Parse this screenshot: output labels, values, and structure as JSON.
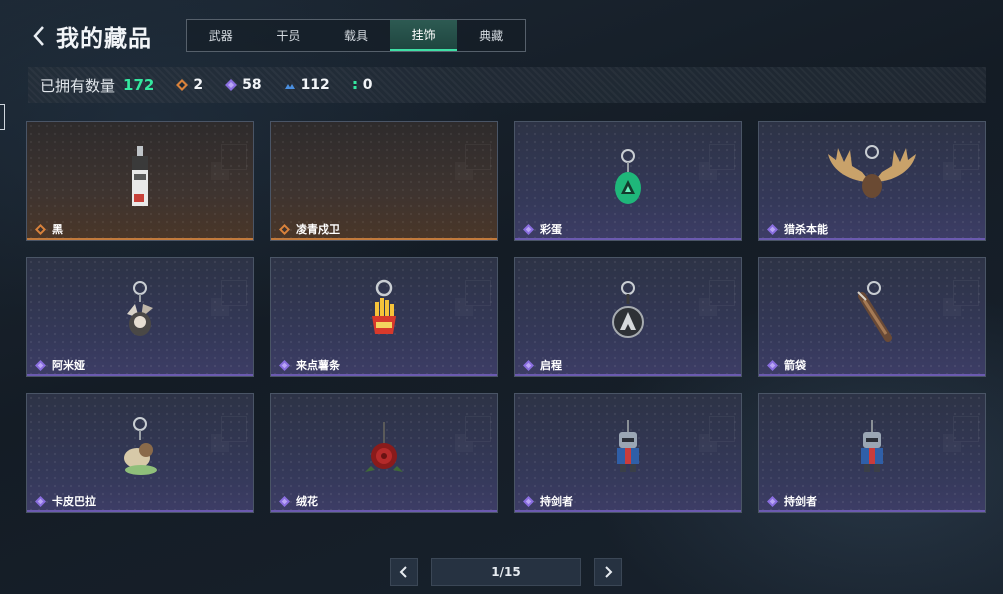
{
  "header": {
    "title": "我的藏品",
    "back_icon": "chevron-left-icon"
  },
  "tabs": [
    {
      "label": "武器",
      "active": false
    },
    {
      "label": "干员",
      "active": false
    },
    {
      "label": "载具",
      "active": false
    },
    {
      "label": "挂饰",
      "active": true
    },
    {
      "label": "典藏",
      "active": false
    }
  ],
  "stats": {
    "owned_label": "已拥有数量",
    "owned_total": "172",
    "counts": [
      {
        "icon": "orange-diamond-icon",
        "value": "2",
        "color": "#d9823b"
      },
      {
        "icon": "purple-diamond-icon",
        "value": "58",
        "color": "#8a6ee0"
      },
      {
        "icon": "blue-chevrons-icon",
        "value": "112",
        "color": "#4a8fe0"
      },
      {
        "icon": "green-dots-icon",
        "value": "0",
        "color": "#34e8a0"
      }
    ]
  },
  "items": [
    {
      "name": "黑",
      "rarity": "orange",
      "art": "tag-charm-icon"
    },
    {
      "name": "凌青戍卫",
      "rarity": "orange",
      "art": "empty"
    },
    {
      "name": "彩蛋",
      "rarity": "purple",
      "art": "green-egg-charm-icon"
    },
    {
      "name": "猎杀本能",
      "rarity": "purple",
      "art": "antler-charm-icon"
    },
    {
      "name": "阿米娅",
      "rarity": "purple",
      "art": "bunny-charm-icon"
    },
    {
      "name": "来点薯条",
      "rarity": "purple",
      "art": "fries-charm-icon"
    },
    {
      "name": "启程",
      "rarity": "purple",
      "art": "emblem-charm-icon"
    },
    {
      "name": "箭袋",
      "rarity": "purple",
      "art": "quiver-charm-icon"
    },
    {
      "name": "卡皮巴拉",
      "rarity": "purple",
      "art": "capybara-charm-icon"
    },
    {
      "name": "绒花",
      "rarity": "purple",
      "art": "rose-charm-icon"
    },
    {
      "name": "持剑者",
      "rarity": "purple",
      "art": "knight-charm-icon"
    },
    {
      "name": "持剑者",
      "rarity": "purple",
      "art": "knight-charm-icon"
    }
  ],
  "pagination": {
    "page_text": "1/15"
  },
  "colors": {
    "accent": "#34e8a0",
    "orange_rarity": "#d9823b",
    "purple_rarity": "#8a6ee0"
  }
}
